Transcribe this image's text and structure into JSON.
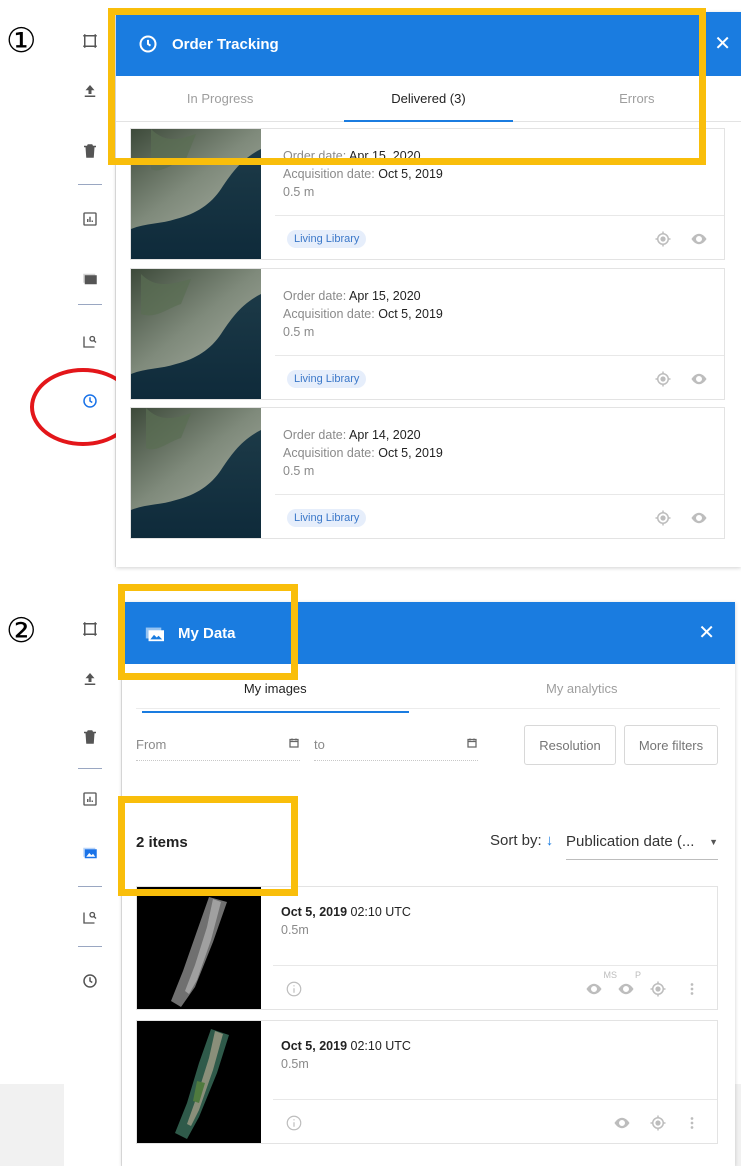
{
  "step1": "①",
  "step2": "②",
  "order_tracking": {
    "title": "Order Tracking",
    "tabs": [
      {
        "label": "In Progress",
        "active": false
      },
      {
        "label": "Delivered (3)",
        "active": true
      },
      {
        "label": "Errors",
        "active": false
      }
    ],
    "orders": [
      {
        "order_label": "Order date:",
        "order_date": "Apr 15, 2020",
        "acq_label": "Acquisition date:",
        "acq_date": "Oct 5, 2019",
        "resolution": "0.5 m",
        "badge": "Living Library"
      },
      {
        "order_label": "Order date:",
        "order_date": "Apr 15, 2020",
        "acq_label": "Acquisition date:",
        "acq_date": "Oct 5, 2019",
        "resolution": "0.5 m",
        "badge": "Living Library"
      },
      {
        "order_label": "Order date:",
        "order_date": "Apr 14, 2020",
        "acq_label": "Acquisition date:",
        "acq_date": "Oct 5, 2019",
        "resolution": "0.5 m",
        "badge": "Living Library"
      }
    ]
  },
  "my_data": {
    "title": "My Data",
    "tabs": [
      {
        "label": "My images",
        "active": true
      },
      {
        "label": "My analytics",
        "active": false
      }
    ],
    "from_placeholder": "From",
    "to_placeholder": "to",
    "resolution_btn": "Resolution",
    "more_filters_btn": "More filters",
    "count": "2 items",
    "sort_label": "Sort by:",
    "sort_value": "Publication date (...",
    "images": [
      {
        "date": "Oct 5, 2019",
        "time": "02:10 UTC",
        "resolution": "0.5m",
        "ms_label": "MS",
        "p_label": "P"
      },
      {
        "date": "Oct 5, 2019",
        "time": "02:10 UTC",
        "resolution": "0.5m"
      }
    ]
  },
  "colors": {
    "header_blue": "#1a7ce0",
    "highlight_yellow": "#f9be0b",
    "highlight_red": "#e3161a"
  }
}
